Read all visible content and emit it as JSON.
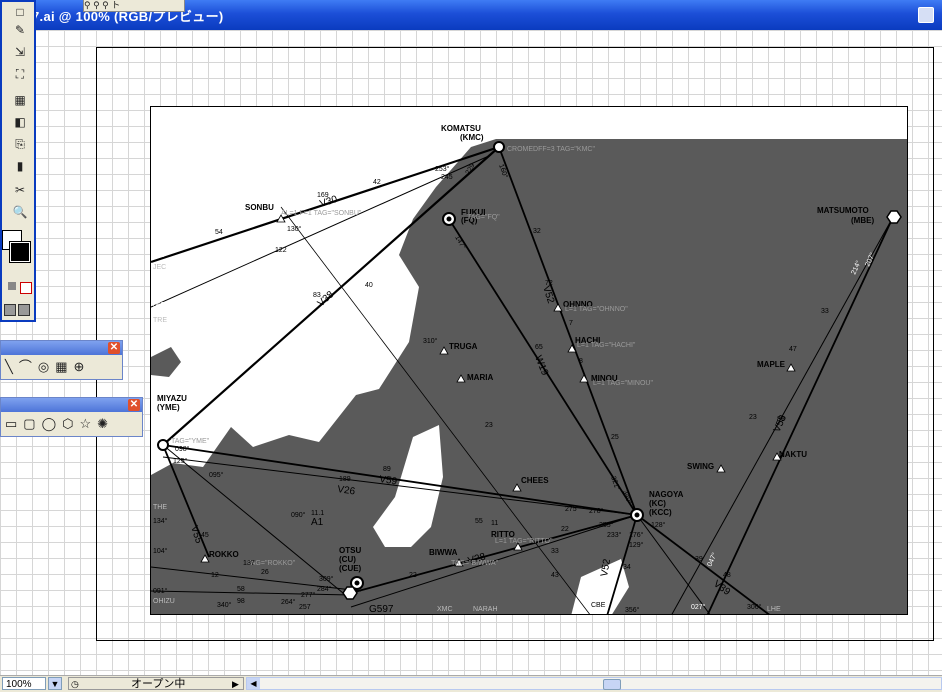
{
  "window": {
    "title": "7.ai @ 100% (RGB/プレビュー)",
    "mini_toolbar": "⚲ ⚲ ⚲ ト"
  },
  "status": {
    "zoom": "100%",
    "text": "オープン中"
  },
  "toolbox": {
    "tools": [
      "□",
      "✎",
      "⇲",
      "⛶",
      "▦",
      "▮",
      "◧",
      "⎘",
      "✂",
      "✋",
      "🔍"
    ]
  },
  "palettes": {
    "line_tools": [
      "╲",
      "⌒",
      "◎",
      "▦",
      "⊕"
    ],
    "shape_tools": [
      "▭",
      "▢",
      "◯",
      "⬡",
      "☆",
      "✺"
    ]
  },
  "map": {
    "colors": {
      "terrain": "#595959",
      "water": "#ffffff",
      "route": "#000000",
      "ref_text": "#999999"
    },
    "fixes": [
      {
        "name": "KOMATSU",
        "sub": "(KMC)"
      },
      {
        "name": "FUKUI",
        "sub": "(FQ)"
      },
      {
        "name": "MATSUMOTO",
        "sub": "(MBE)"
      },
      {
        "name": "SONBU",
        "sub": ""
      },
      {
        "name": "MIYAZU",
        "sub": "(YME)"
      },
      {
        "name": "OHNNO",
        "sub": ""
      },
      {
        "name": "HACHI",
        "sub": ""
      },
      {
        "name": "MINOU",
        "sub": ""
      },
      {
        "name": "TRUGA",
        "sub": ""
      },
      {
        "name": "MARIA",
        "sub": ""
      },
      {
        "name": "MAPLE",
        "sub": ""
      },
      {
        "name": "SWING",
        "sub": ""
      },
      {
        "name": "NAKTU",
        "sub": ""
      },
      {
        "name": "CHEES",
        "sub": ""
      },
      {
        "name": "NAGOYA",
        "sub": "(KC)"
      },
      {
        "name": "(KCC)",
        "sub": ""
      },
      {
        "name": "RITTO",
        "sub": ""
      },
      {
        "name": "BIWWA",
        "sub": ""
      },
      {
        "name": "ROKKO",
        "sub": ""
      },
      {
        "name": "OTSU",
        "sub": "(CU)"
      },
      {
        "name": "(CUE)",
        "sub": ""
      }
    ],
    "airways": [
      "V30",
      "V38",
      "W19",
      "V52",
      "V58",
      "V59",
      "V26",
      "V28",
      "V55",
      "G597",
      "V39",
      "A1",
      "V52",
      "V53"
    ],
    "labels": {
      "jec": "JEC",
      "tre": "TRE",
      "the": "THE",
      "ohizu": "OHIZU",
      "xmc": "XMC",
      "narah": "NARAH",
      "lhe": "LHE",
      "cbe": "CBE",
      "a1_dist": "11.1",
      "a1_bearing": "090°"
    },
    "ref_texts": [
      "CROMEDFF=3 TAG=\"KMC\"",
      "AL=1 F=1 TAG=\"SONBU\"",
      "TAG=\"FQ\"",
      "L=1 TAG=\"OHNNO\"",
      "L=1 TAG=\"HACHI\"",
      "L=1 TAG=\"MINOU\"",
      "TAG=\"YME\"",
      "L=1 TAG=\"RITTO\"",
      "TAG=\"BIWWA\"",
      "TAG=\"ROKKO\""
    ],
    "numbers": [
      "169",
      "42",
      "253°",
      "245",
      "229",
      "54",
      "073°",
      "122",
      "130°",
      "065°",
      "83",
      "40",
      "310°",
      "160°",
      "147°",
      "32",
      "72",
      "65",
      "7",
      "8",
      "23",
      "25",
      "321°",
      "340°",
      "047°",
      "214°",
      "207°",
      "33",
      "47",
      "23",
      "89",
      "89",
      "189",
      "098°",
      "125°",
      "095°",
      "275°",
      "278°",
      "255°",
      "233°",
      "55",
      "11",
      "22",
      "33",
      "43",
      "22",
      "45",
      "137",
      "26",
      "309°",
      "284°",
      "277°",
      "264°",
      "257",
      "58",
      "98",
      "091°",
      "104°",
      "134°",
      "12",
      "340°",
      "39",
      "48",
      "306°",
      "027°",
      "128°",
      "129°",
      "34",
      "176°",
      "356°"
    ]
  }
}
